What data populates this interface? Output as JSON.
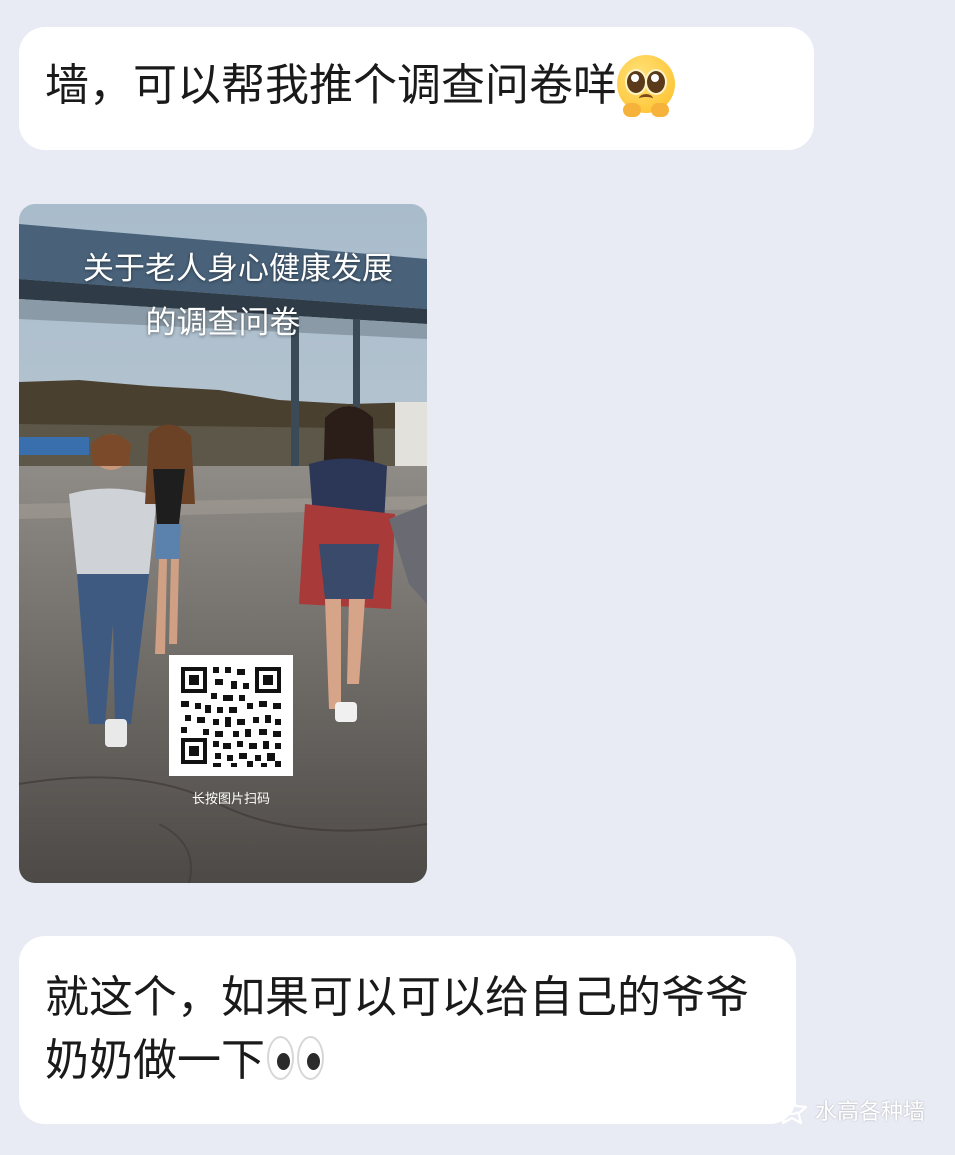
{
  "messages": [
    {
      "text": "墙，可以帮我推个调查问卷咩",
      "emoji": "pleading-face-icon"
    },
    {
      "type": "image",
      "poster": {
        "title_line_1": "关于老人身心健康发展",
        "title_line_2": "的调查问卷",
        "qr_caption": "长按图片扫码"
      }
    },
    {
      "text": "就这个，如果可以可以给自己的爷爷奶奶做一下",
      "emoji": "eyes-icon"
    }
  ],
  "watermark": {
    "text": "水高各种墙",
    "icon": "star-logo-icon"
  },
  "colors": {
    "background": "#e9ebf4",
    "bubble": "#ffffff",
    "text": "#1a1a1a"
  }
}
